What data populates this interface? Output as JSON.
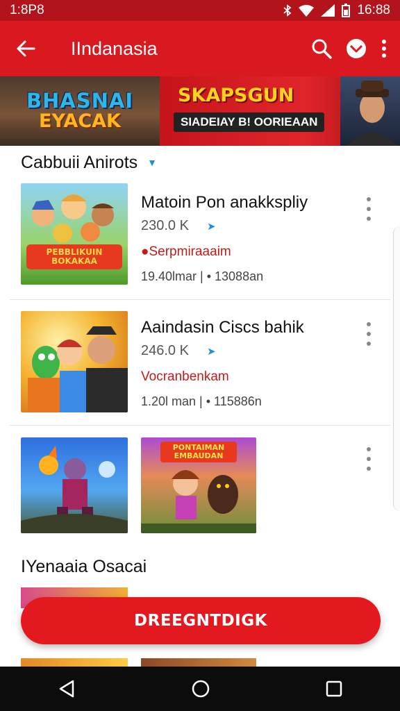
{
  "status_bar": {
    "time_left": "1:8P8",
    "time_right": "16:88"
  },
  "app_bar": {
    "title": "IIndanasia"
  },
  "banner": {
    "left_line1": "BHASNAI",
    "left_line2": "EYACAK",
    "right_title": "SKAPSGUN",
    "right_subtitle": "SIADEIAY B! OORIEAAN"
  },
  "sections": [
    {
      "title": "Cabbuii Anirots"
    },
    {
      "title": "IYenaaia Osacai"
    }
  ],
  "apps": [
    {
      "title": "Matoin Pon anakkspliy",
      "count": "230.0 K",
      "developer": "Serpmiraaaim",
      "meta": "19.40lmar | • 13088an"
    },
    {
      "title": "Aaindasin Ciscs bahik",
      "count": "246.0 K",
      "developer": "Vocranbenkam",
      "meta": "1.20l man | • 115886n"
    },
    {
      "title": "",
      "count": "",
      "developer": "",
      "meta": ""
    }
  ],
  "thumb3b_text": {
    "line1": "PONTAIMAN",
    "line2": "EMBAUDAN"
  },
  "thumb1_text": {
    "line1": "PEBBLIKUIN",
    "line2": "BOKAKAA"
  },
  "fab": {
    "label": "DREEGNTDIGK"
  },
  "colors": {
    "primary": "#d9191f",
    "status": "#b3141b",
    "accent": "#1e8fd6"
  }
}
